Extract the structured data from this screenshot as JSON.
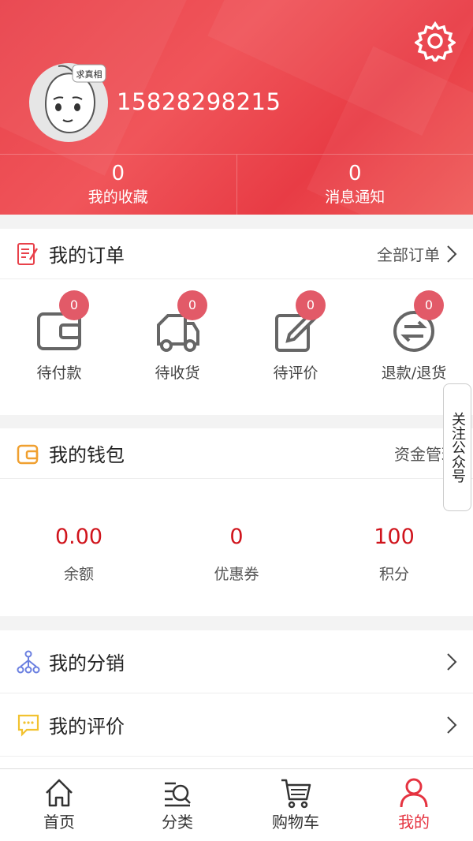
{
  "header": {
    "phone": "15828298215",
    "avatar_caption": "求真相",
    "stats": [
      {
        "value": "0",
        "label": "我的收藏"
      },
      {
        "value": "0",
        "label": "消息通知"
      }
    ]
  },
  "orders": {
    "title": "我的订单",
    "all_label": "全部订单",
    "items": [
      {
        "label": "待付款",
        "count": "0"
      },
      {
        "label": "待收货",
        "count": "0"
      },
      {
        "label": "待评价",
        "count": "0"
      },
      {
        "label": "退款/退货",
        "count": "0"
      }
    ]
  },
  "wallet": {
    "title": "我的钱包",
    "manage_label": "资金管理",
    "items": [
      {
        "value": "0.00",
        "label": "余额"
      },
      {
        "value": "0",
        "label": "优惠券"
      },
      {
        "value": "100",
        "label": "积分"
      }
    ]
  },
  "menu": [
    {
      "label": "我的分销"
    },
    {
      "label": "我的评价"
    }
  ],
  "follow_tab": "关注公众号",
  "tabbar": [
    {
      "label": "首页",
      "icon": "home-icon"
    },
    {
      "label": "分类",
      "icon": "category-icon"
    },
    {
      "label": "购物车",
      "icon": "cart-icon"
    },
    {
      "label": "我的",
      "icon": "user-icon",
      "active": true
    }
  ],
  "colors": {
    "brand_red": "#e8414a",
    "value_red": "#d0141c",
    "badge": "#e25a68",
    "active_tab": "#e53340"
  }
}
